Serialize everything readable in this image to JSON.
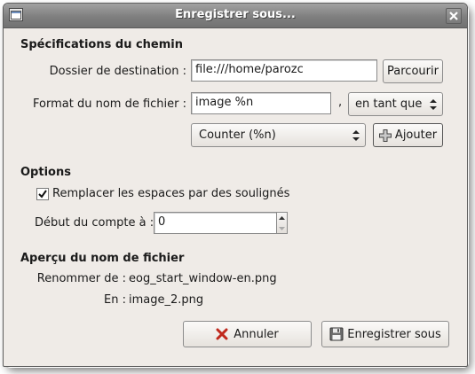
{
  "window": {
    "title": "Enregistrer sous..."
  },
  "path_spec": {
    "heading": "Spécifications du chemin",
    "dest_label": "Dossier de destination :",
    "dest_value": "file:///home/parozc",
    "browse_label": "Parcourir",
    "format_label": "Format du nom de fichier :",
    "format_value": "image %n",
    "separator": ",",
    "as_combo": "en tant que",
    "token_combo": "Counter (%n)",
    "add_label": "Ajouter"
  },
  "options": {
    "heading": "Options",
    "replace_spaces_label": "Remplacer les espaces par des soulignés",
    "replace_spaces_checked": true,
    "counter_start_label": "Début du compte à :",
    "counter_start_value": "0"
  },
  "preview": {
    "heading": "Aperçu du nom de fichier",
    "rename_label": "Renommer de :",
    "rename_value": "eog_start_window-en.png",
    "to_label": "En :",
    "to_value": "image_2.png"
  },
  "actions": {
    "cancel_label": "Annuler",
    "save_label": "Enregistrer sous"
  },
  "colors": {
    "titlebar": "#7f7f7f",
    "dialog_bg": "#efebe7"
  }
}
